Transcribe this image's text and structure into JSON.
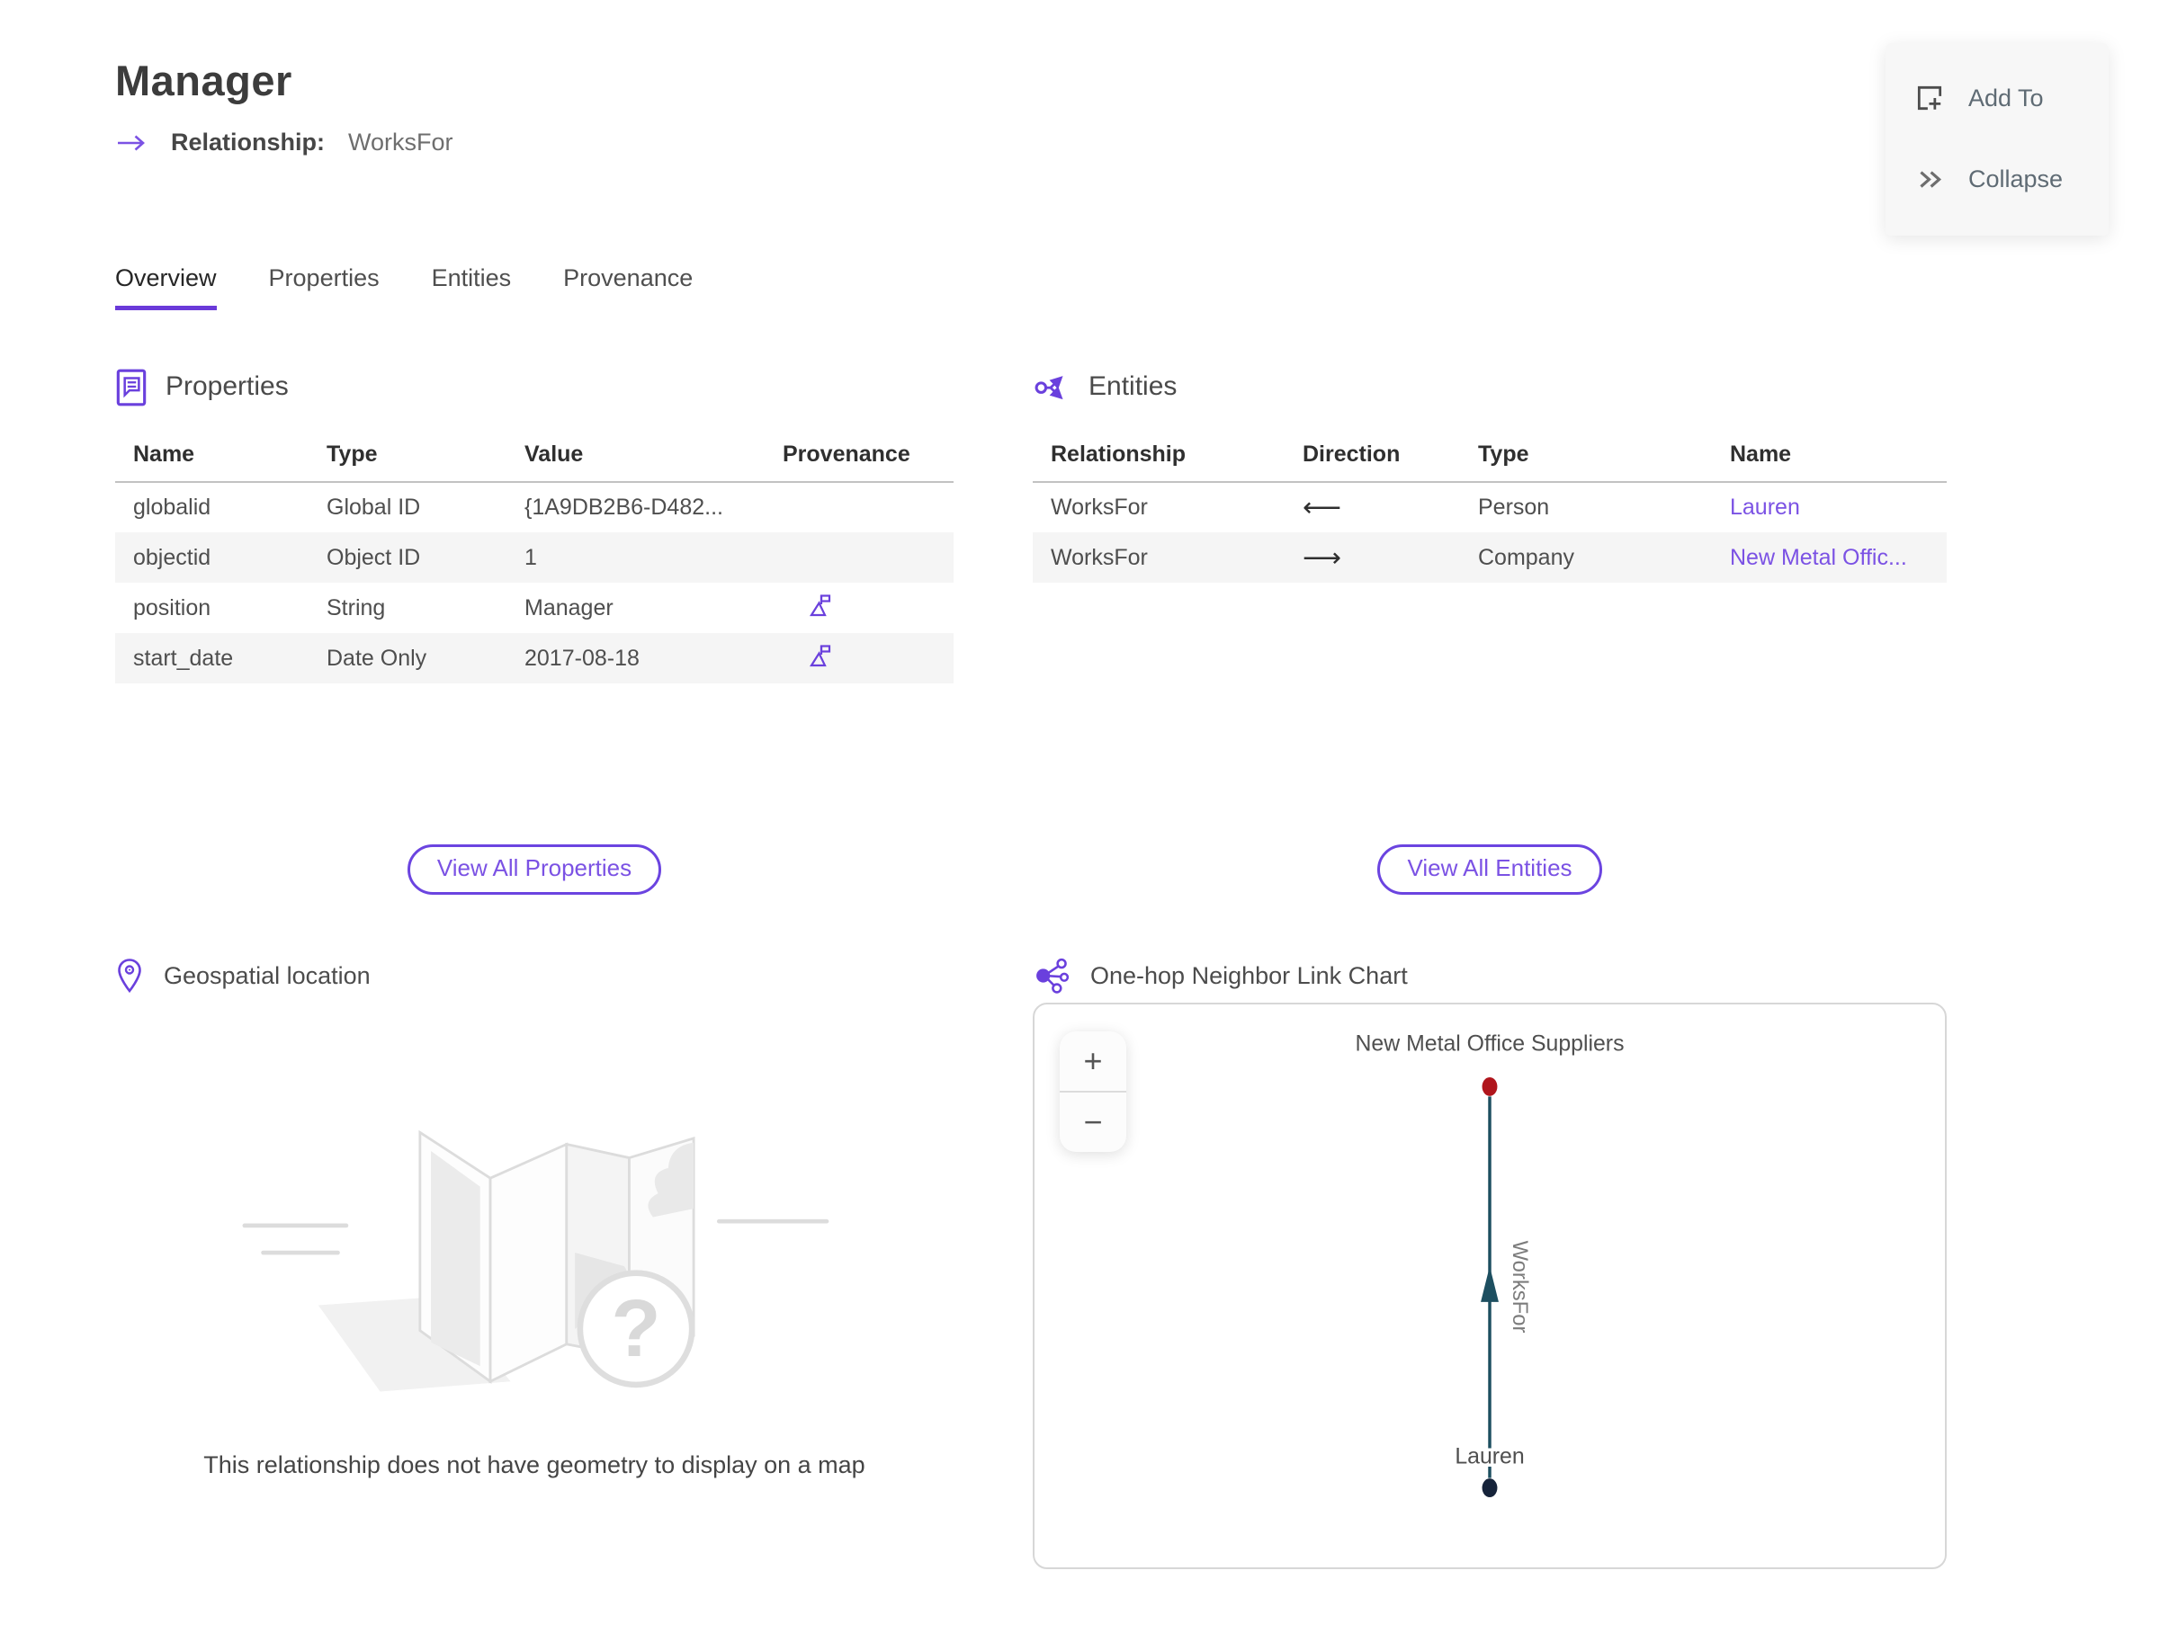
{
  "header": {
    "title": "Manager",
    "relationship_label": "Relationship:",
    "relationship_value": "WorksFor"
  },
  "action_panel": {
    "add_to": "Add To",
    "collapse": "Collapse"
  },
  "tabs": {
    "overview": "Overview",
    "properties": "Properties",
    "entities": "Entities",
    "provenance": "Provenance"
  },
  "properties_section": {
    "title": "Properties",
    "headers": {
      "name": "Name",
      "type": "Type",
      "value": "Value",
      "provenance": "Provenance"
    },
    "rows": [
      {
        "name": "globalid",
        "type": "Global ID",
        "value": "{1A9DB2B6-D482..."
      },
      {
        "name": "objectid",
        "type": "Object ID",
        "value": "1"
      },
      {
        "name": "position",
        "type": "String",
        "value": "Manager"
      },
      {
        "name": "start_date",
        "type": "Date Only",
        "value": "2017-08-18"
      }
    ],
    "view_all": "View All Properties"
  },
  "entities_section": {
    "title": "Entities",
    "headers": {
      "relationship": "Relationship",
      "direction": "Direction",
      "type": "Type",
      "name": "Name"
    },
    "rows": [
      {
        "relationship": "WorksFor",
        "direction": "⟵",
        "type": "Person",
        "name": "Lauren"
      },
      {
        "relationship": "WorksFor",
        "direction": "⟶",
        "type": "Company",
        "name": "New Metal Offic..."
      }
    ],
    "view_all": "View All Entities"
  },
  "geospatial_section": {
    "title": "Geospatial location",
    "empty_message": "This relationship does not have geometry to display on a map"
  },
  "link_chart_section": {
    "title": "One-hop Neighbor Link Chart",
    "zoom_in_label": "+",
    "zoom_out_label": "−",
    "graph": {
      "top_node": {
        "label": "New Metal Office Suppliers",
        "color": "#b0151c"
      },
      "bottom_node": {
        "label": "Lauren",
        "color": "#16233a"
      },
      "edge": {
        "label": "WorksFor",
        "color": "#1d4f60",
        "direction": "bottom-to-top"
      }
    }
  },
  "colors": {
    "accent_purple": "#6a40dd",
    "link_purple": "#7b52e4",
    "tab_underline": "#6a3ad9",
    "edge_teal": "#1d4f60",
    "node_red": "#b0151c",
    "node_navy": "#16233a"
  }
}
